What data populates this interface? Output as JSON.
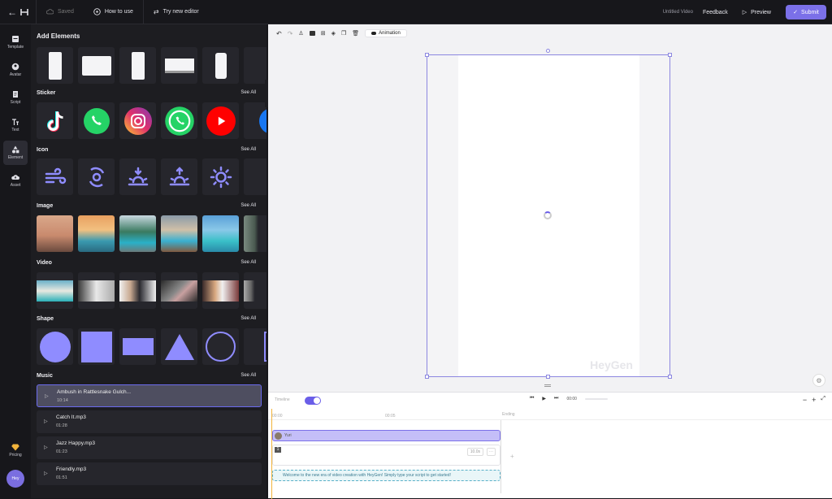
{
  "topbar": {
    "saved_label": "Saved",
    "how_to_use": "How to use",
    "try_new_editor": "Try new editor",
    "untitled": "Untitled Video",
    "feedback": "Feedback",
    "preview": "Preview",
    "submit": "Submit"
  },
  "leftnav": {
    "items": [
      "Template",
      "Avatar",
      "Script",
      "Text",
      "Element",
      "Asset"
    ],
    "active": "Element",
    "pricing": "Pricing",
    "avatar_initials": "Hey"
  },
  "panel": {
    "title": "Add Elements",
    "see_all": "See All",
    "sections": {
      "sticker": "Sticker",
      "icon": "Icon",
      "image": "Image",
      "video": "Video",
      "shape": "Shape",
      "music": "Music"
    },
    "music": [
      {
        "title": "Ambush in Rattlesnake Gulch...",
        "duration": "10:14"
      },
      {
        "title": "Catch It.mp3",
        "duration": "01:28"
      },
      {
        "title": "Jazz Happy.mp3",
        "duration": "01:23"
      },
      {
        "title": "Friendly.mp3",
        "duration": "01:51"
      }
    ]
  },
  "canvas": {
    "animation_label": "Animation",
    "watermark": "HeyGen"
  },
  "timeline": {
    "mode_label": "Timeline",
    "time": "00:00",
    "ruler_start": "00:00",
    "ruler_mid": "00:05",
    "ending": "Ending",
    "voice_label": "Yuri",
    "scene_number": "1",
    "scene_duration": "10.0s",
    "script_text": "Welcome to the new era of video creation with HeyGen! Simply type your script to get started!"
  },
  "colors": {
    "accent": "#7b70e8",
    "panel_bg": "#1d1d21",
    "app_bg": "#17171b"
  }
}
